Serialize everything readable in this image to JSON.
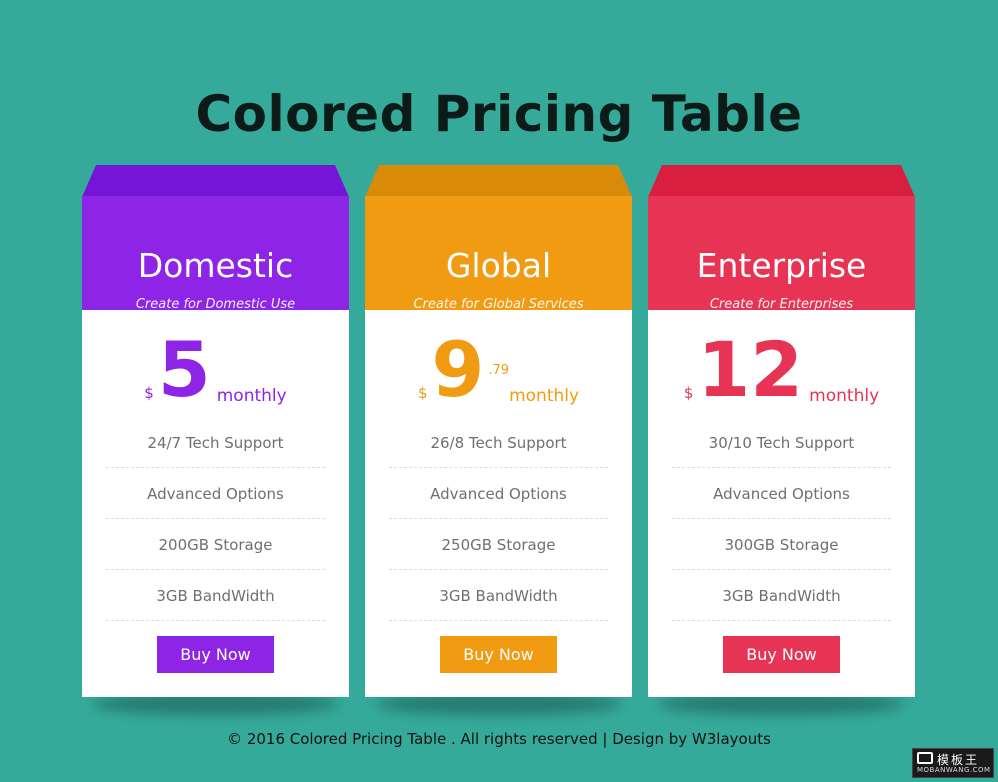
{
  "page": {
    "title": "Colored Pricing Table",
    "footer": "© 2016 Colored Pricing Table . All rights reserved | Design by W3layouts"
  },
  "plans": [
    {
      "name": "Domestic",
      "subtitle": "Create for Domestic Use",
      "currency": "$",
      "amount": "5",
      "cents": "",
      "period": "monthly",
      "features": [
        "24/7 Tech Support",
        "Advanced Options",
        "200GB Storage",
        "3GB BandWidth"
      ],
      "button": "Buy Now",
      "color": "#8e24e6",
      "lip_color": "#7516d6"
    },
    {
      "name": "Global",
      "subtitle": "Create for Global Services",
      "currency": "$",
      "amount": "9",
      "cents": ".79",
      "period": "monthly",
      "features": [
        "26/8 Tech Support",
        "Advanced Options",
        "250GB Storage",
        "3GB BandWidth"
      ],
      "button": "Buy Now",
      "color": "#f19b12",
      "lip_color": "#d98a08"
    },
    {
      "name": "Enterprise",
      "subtitle": "Create for Enterprises",
      "currency": "$",
      "amount": "12",
      "cents": "",
      "period": "monthly",
      "features": [
        "30/10 Tech Support",
        "Advanced Options",
        "300GB Storage",
        "3GB BandWidth"
      ],
      "button": "Buy Now",
      "color": "#e73454",
      "lip_color": "#d81f3f"
    }
  ],
  "watermark": {
    "top": "模板王",
    "bottom": "MOBANWANG.COM"
  }
}
